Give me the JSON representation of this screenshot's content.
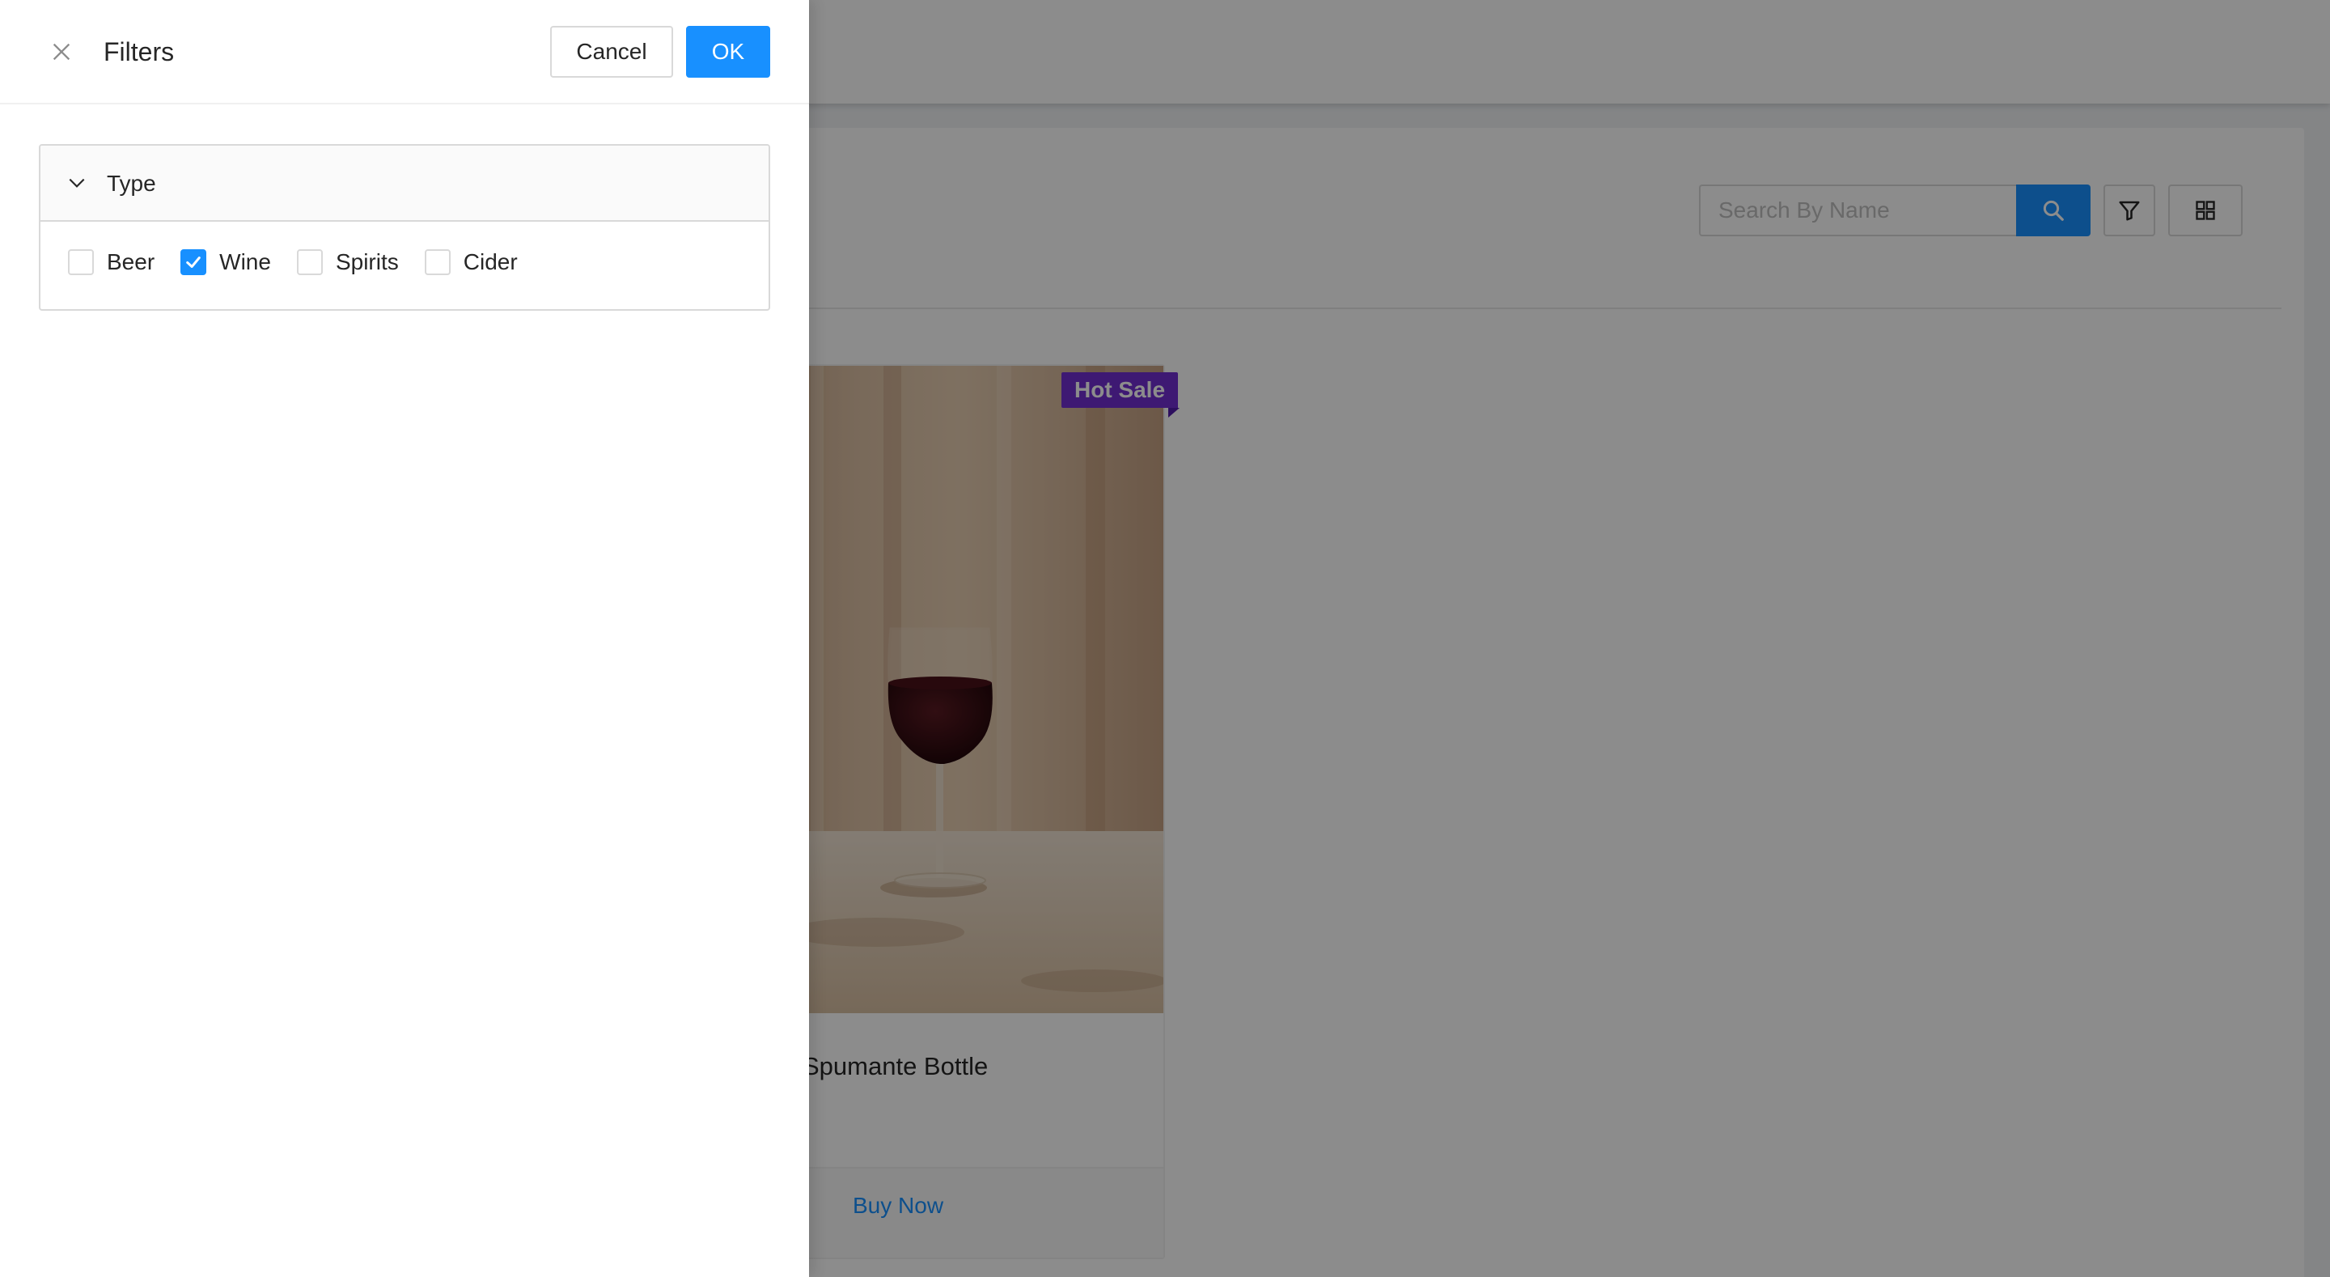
{
  "drawer": {
    "title": "Filters",
    "cancel_label": "Cancel",
    "ok_label": "OK",
    "section": {
      "title": "Type",
      "expanded": true,
      "options": [
        {
          "label": "Beer",
          "checked": false
        },
        {
          "label": "Wine",
          "checked": true
        },
        {
          "label": "Spirits",
          "checked": false
        },
        {
          "label": "Cider",
          "checked": false
        }
      ]
    }
  },
  "toolbar": {
    "search_placeholder": "Search By Name"
  },
  "product": {
    "name": "Spumante Bottle",
    "badge": "Hot Sale",
    "action_label": "Buy Now"
  },
  "colors": {
    "primary": "#1890ff",
    "badge": "#722ed1",
    "mask": "rgba(0,0,0,0.45)"
  }
}
